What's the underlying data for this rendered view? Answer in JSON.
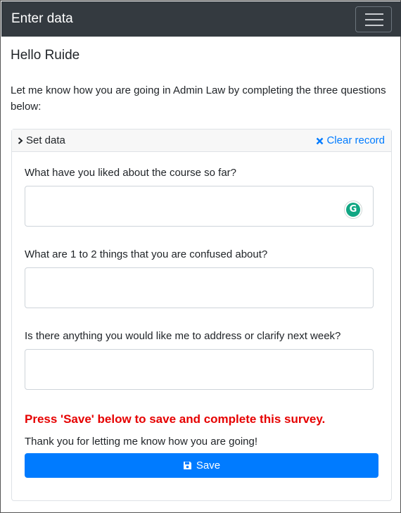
{
  "navbar": {
    "title": "Enter data",
    "toggler_icon": "hamburger-menu-icon"
  },
  "greeting": "Hello Ruide",
  "intro": "Let me know how you are going in Admin Law by completing the three questions below:",
  "card": {
    "header_label": "Set data",
    "clear_label": "Clear record",
    "questions": [
      {
        "label": "What have you liked about the course so far?",
        "value": ""
      },
      {
        "label": "What are 1 to 2 things that you are confused about?",
        "value": ""
      },
      {
        "label": "Is there anything you would like me to address or clarify next week?",
        "value": ""
      }
    ],
    "warning": "Press 'Save' below to save and complete this survey.",
    "thanks": "Thank you for letting me know how you are going!",
    "save_label": "Save"
  },
  "colors": {
    "navbar": "#343a40",
    "primary": "#007bff",
    "warning": "#e60000"
  }
}
